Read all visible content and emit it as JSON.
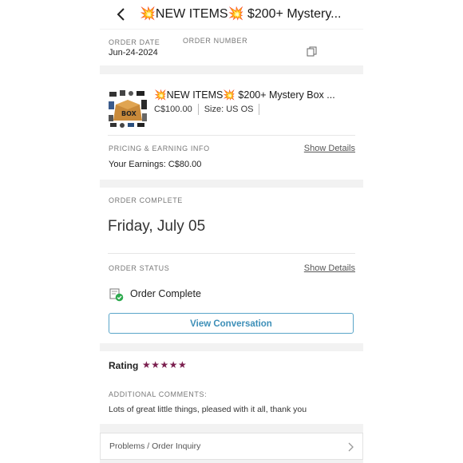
{
  "header": {
    "title": "💥NEW ITEMS💥 $200+ Mystery..."
  },
  "order_info": {
    "date_label": "ORDER DATE",
    "date_value": "Jun-24-2024",
    "number_label": "ORDER NUMBER"
  },
  "product": {
    "title": "💥NEW ITEMS💥 $200+ Mystery Box ...",
    "price": "C$100.00",
    "size": "Size: US OS",
    "thumbnail_text": "BOX"
  },
  "pricing": {
    "label": "PRICING & EARNING INFO",
    "show_details": "Show Details",
    "earnings": "Your Earnings: C$80.00"
  },
  "completion": {
    "label": "ORDER COMPLETE",
    "date": "Friday, July 05",
    "status_label": "ORDER STATUS",
    "show_details": "Show Details",
    "status_text": "Order Complete",
    "button_label": "View Conversation"
  },
  "rating": {
    "label": "Rating",
    "stars": "★★★★★",
    "star_count": 5,
    "comments_label": "ADDITIONAL COMMENTS:",
    "comment": "Lots of great little things, pleased with it all, thank you"
  },
  "problems": {
    "label": "Problems / Order Inquiry"
  },
  "colors": {
    "accent": "#3d8fb8",
    "star": "#7b1f4f",
    "status_check": "#2eaa4f"
  },
  "icons": {
    "back": "chevron-left-icon",
    "copy": "copy-icon",
    "status": "order-complete-icon",
    "problems": "chevron-right-icon"
  }
}
